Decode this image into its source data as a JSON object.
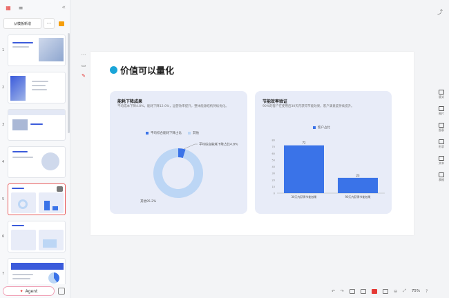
{
  "sidebar": {
    "new_slide_label": "从模板新增",
    "more_label": "···",
    "collapse_label": "«",
    "thumbnails": [
      {
        "num": "1"
      },
      {
        "num": "2"
      },
      {
        "num": "3"
      },
      {
        "num": "4"
      },
      {
        "num": "5"
      },
      {
        "num": "6"
      },
      {
        "num": "7"
      }
    ],
    "agent_label": "Agent"
  },
  "slide": {
    "title": "价值可以量化",
    "footer": "",
    "left_card": {
      "title": "能耗下降成果",
      "desc": "平均成本下降4.8%，能耗下降12.0%，运营效率提升，整体能源结构持续优化。",
      "legend": [
        "平均综合能耗下降占比",
        "其他"
      ],
      "label_top": "平均综合能耗下降占比4.8%",
      "label_bottom": "其他95.2%",
      "chart_data": {
        "type": "pie",
        "categories": [
          "平均综合能耗下降占比",
          "其他"
        ],
        "values": [
          4.8,
          95.2
        ],
        "colors": [
          "#3a73e8",
          "#bcd6f5"
        ]
      }
    },
    "right_card": {
      "title": "节能效率验证",
      "desc": "90%的客户在使用后30天内获得节能效果，客户满意度持续提升。",
      "legend": [
        "客户占比"
      ],
      "chart_data": {
        "type": "bar",
        "categories": [
          "30天内获得节能效果",
          "90天内获得节能效果"
        ],
        "values": [
          72,
          23
        ],
        "series": [
          {
            "name": "客户占比",
            "values": [
              72,
              23
            ]
          }
        ],
        "ylim": [
          0,
          80
        ],
        "yticks": [
          "0",
          "10",
          "20",
          "30",
          "40",
          "50",
          "60",
          "70",
          "80"
        ],
        "color": "#3a73e8"
      }
    }
  },
  "right_rail": [
    {
      "icon": "layout-icon",
      "label": "版式"
    },
    {
      "icon": "image-icon",
      "label": "图片"
    },
    {
      "icon": "chart-icon",
      "label": "图表"
    },
    {
      "icon": "shape-icon",
      "label": "形状"
    },
    {
      "icon": "text-icon",
      "label": "文本"
    },
    {
      "icon": "table-icon",
      "label": "表格"
    }
  ],
  "bottom_bar": {
    "zoom": "75%"
  }
}
